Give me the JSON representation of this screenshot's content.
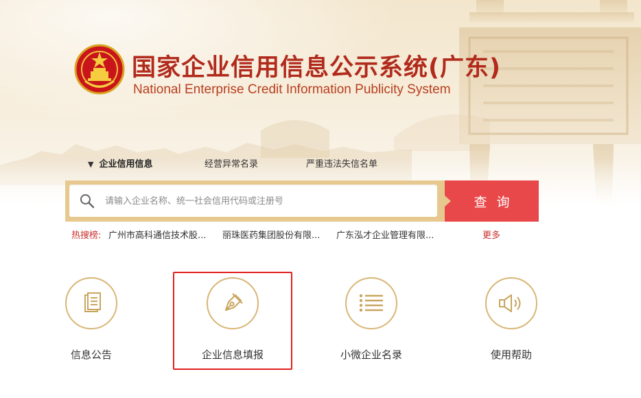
{
  "header": {
    "title_cn": "国家企业信用信息公示系统(广东)",
    "title_en": "National Enterprise Credit Information Publicity System",
    "emblem_icon": "national-emblem-icon"
  },
  "tabs": [
    {
      "label": "企业信用信息",
      "active": true
    },
    {
      "label": "经营异常名录",
      "active": false
    },
    {
      "label": "严重违法失信名单",
      "active": false
    }
  ],
  "search": {
    "placeholder": "请输入企业名称、统一社会信用代码或注册号",
    "value": "",
    "button_label": "查询"
  },
  "hot_search": {
    "label": "热搜榜:",
    "items": [
      "广州市高科通信技术股...",
      "丽珠医药集团股份有限...",
      "广东泓才企业管理有限..."
    ],
    "more_label": "更多"
  },
  "features": [
    {
      "label": "信息公告",
      "icon": "document-icon"
    },
    {
      "label": "企业信息填报",
      "icon": "pen-nib-icon",
      "highlighted": true
    },
    {
      "label": "小微企业名录",
      "icon": "list-icon"
    },
    {
      "label": "使用帮助",
      "icon": "speaker-icon"
    }
  ],
  "colors": {
    "brand_red": "#b12a1c",
    "search_button": "#e9484a",
    "gold": "#d8b574",
    "highlight_box": "#e21d1d"
  }
}
